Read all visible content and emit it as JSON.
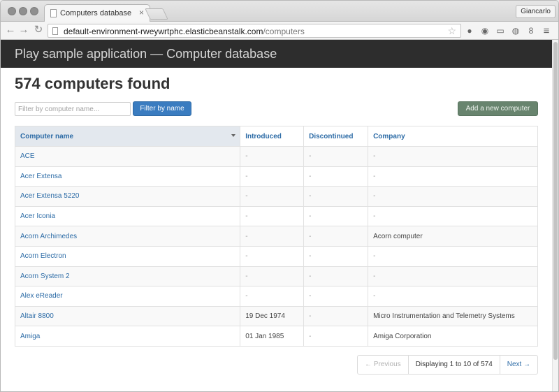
{
  "browser": {
    "tab_title": "Computers database",
    "tab_close": "×",
    "profile_name": "Giancarlo",
    "url_host": "default-environment-rweywrtphc.elasticbeanstalk.com",
    "url_path": "/computers",
    "back_icon": "←",
    "forward_icon": "→",
    "reload_icon": "↻",
    "star_icon": "☆",
    "menu_icon": "≡"
  },
  "app": {
    "brand": "Play sample application — Computer database",
    "heading": "574 computers found",
    "filter_placeholder": "Filter by computer name...",
    "filter_button": "Filter by name",
    "add_button": "Add a new computer"
  },
  "table": {
    "columns": [
      "Computer name",
      "Introduced",
      "Discontinued",
      "Company"
    ],
    "sorted_column": "Computer name",
    "rows": [
      {
        "name": "ACE",
        "introduced": "-",
        "discontinued": "-",
        "company": "-"
      },
      {
        "name": "Acer Extensa",
        "introduced": "-",
        "discontinued": "-",
        "company": "-"
      },
      {
        "name": "Acer Extensa 5220",
        "introduced": "-",
        "discontinued": "-",
        "company": "-"
      },
      {
        "name": "Acer Iconia",
        "introduced": "-",
        "discontinued": "-",
        "company": "-"
      },
      {
        "name": "Acorn Archimedes",
        "introduced": "-",
        "discontinued": "-",
        "company": "Acorn computer"
      },
      {
        "name": "Acorn Electron",
        "introduced": "-",
        "discontinued": "-",
        "company": "-"
      },
      {
        "name": "Acorn System 2",
        "introduced": "-",
        "discontinued": "-",
        "company": "-"
      },
      {
        "name": "Alex eReader",
        "introduced": "-",
        "discontinued": "-",
        "company": "-"
      },
      {
        "name": "Altair 8800",
        "introduced": "19 Dec 1974",
        "discontinued": "-",
        "company": "Micro Instrumentation and Telemetry Systems"
      },
      {
        "name": "Amiga",
        "introduced": "01 Jan 1985",
        "discontinued": "-",
        "company": "Amiga Corporation"
      }
    ]
  },
  "pagination": {
    "previous": "← Previous",
    "info": "Displaying 1 to 10 of 574",
    "next": "Next →"
  }
}
